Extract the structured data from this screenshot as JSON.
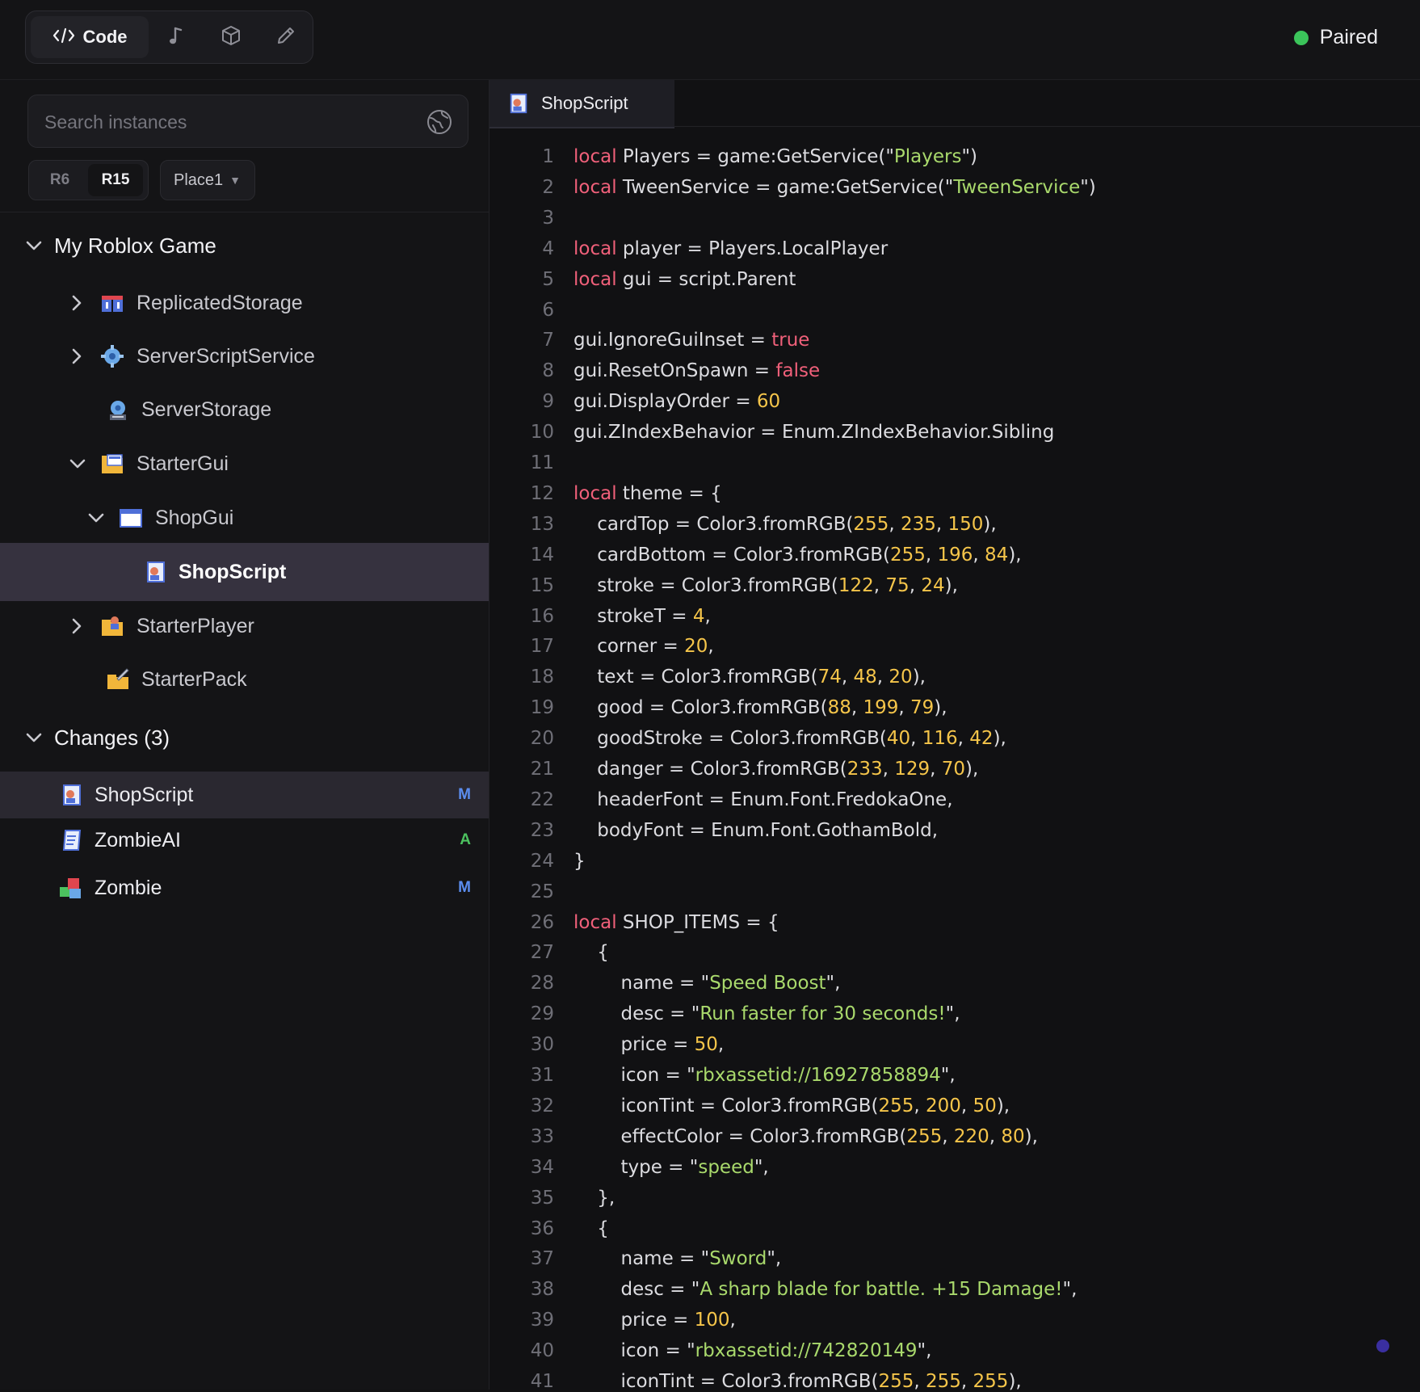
{
  "toolbar": {
    "code_label": "Code",
    "icons": [
      "code-icon",
      "music-note-icon",
      "cube-icon",
      "pencil-icon"
    ]
  },
  "status": {
    "label": "Paired",
    "color": "#3bc45a"
  },
  "sidebar": {
    "search_placeholder": "Search instances",
    "rig_options": [
      "R6",
      "R15"
    ],
    "rig_selected": "R15",
    "place_value": "Place1",
    "tree": {
      "root_label": "My Roblox Game",
      "items": [
        {
          "label": "ReplicatedStorage",
          "icon": "replicated-storage-icon",
          "chevron": "right"
        },
        {
          "label": "ServerScriptService",
          "icon": "server-script-service-icon",
          "chevron": "right"
        },
        {
          "label": "ServerStorage",
          "icon": "server-storage-icon",
          "chevron": "none"
        },
        {
          "label": "StarterGui",
          "icon": "starter-gui-icon",
          "chevron": "down"
        },
        {
          "label": "ShopGui",
          "icon": "screen-gui-icon",
          "chevron": "down"
        },
        {
          "label": "ShopScript",
          "icon": "local-script-icon",
          "chevron": "none",
          "selected": true
        },
        {
          "label": "StarterPlayer",
          "icon": "starter-player-icon",
          "chevron": "right"
        },
        {
          "label": "StarterPack",
          "icon": "starter-pack-icon",
          "chevron": "none"
        }
      ]
    },
    "changes": {
      "header": "Changes (3)",
      "items": [
        {
          "label": "ShopScript",
          "badge": "M",
          "badge_color": "#5b8def",
          "icon": "local-script-icon"
        },
        {
          "label": "ZombieAI",
          "badge": "A",
          "badge_color": "#4cc25f",
          "icon": "script-icon"
        },
        {
          "label": "Zombie",
          "badge": "M",
          "badge_color": "#5b8def",
          "icon": "model-icon"
        }
      ]
    }
  },
  "editor": {
    "tab_label": "ShopScript",
    "lines": [
      {
        "n": "1",
        "tokens": [
          [
            "kw",
            "local"
          ],
          [
            "plain",
            " Players = game:GetService(\""
          ],
          [
            "str",
            "Players"
          ],
          [
            "plain",
            "\")"
          ]
        ]
      },
      {
        "n": "2",
        "tokens": [
          [
            "kw",
            "local"
          ],
          [
            "plain",
            " TweenService = game:GetService(\""
          ],
          [
            "str",
            "TweenService"
          ],
          [
            "plain",
            "\")"
          ]
        ]
      },
      {
        "n": "3",
        "tokens": []
      },
      {
        "n": "4",
        "tokens": [
          [
            "kw",
            "local"
          ],
          [
            "plain",
            " player = Players.LocalPlayer"
          ]
        ]
      },
      {
        "n": "5",
        "tokens": [
          [
            "kw",
            "local"
          ],
          [
            "plain",
            " gui = script.Parent"
          ]
        ]
      },
      {
        "n": "6",
        "tokens": []
      },
      {
        "n": "7",
        "tokens": [
          [
            "plain",
            "gui.IgnoreGuiInset = "
          ],
          [
            "bool",
            "true"
          ]
        ]
      },
      {
        "n": "8",
        "tokens": [
          [
            "plain",
            "gui.ResetOnSpawn = "
          ],
          [
            "bool",
            "false"
          ]
        ]
      },
      {
        "n": "9",
        "tokens": [
          [
            "plain",
            "gui.DisplayOrder = "
          ],
          [
            "num",
            "60"
          ]
        ]
      },
      {
        "n": "10",
        "tokens": [
          [
            "plain",
            "gui.ZIndexBehavior = Enum.ZIndexBehavior.Sibling"
          ]
        ]
      },
      {
        "n": "11",
        "tokens": []
      },
      {
        "n": "12",
        "tokens": [
          [
            "kw",
            "local"
          ],
          [
            "plain",
            " theme = {"
          ]
        ]
      },
      {
        "n": "13",
        "tokens": [
          [
            "plain",
            "    cardTop = Color3.fromRGB("
          ],
          [
            "num",
            "255"
          ],
          [
            "plain",
            ", "
          ],
          [
            "num",
            "235"
          ],
          [
            "plain",
            ", "
          ],
          [
            "num",
            "150"
          ],
          [
            "plain",
            "),"
          ]
        ]
      },
      {
        "n": "14",
        "tokens": [
          [
            "plain",
            "    cardBottom = Color3.fromRGB("
          ],
          [
            "num",
            "255"
          ],
          [
            "plain",
            ", "
          ],
          [
            "num",
            "196"
          ],
          [
            "plain",
            ", "
          ],
          [
            "num",
            "84"
          ],
          [
            "plain",
            "),"
          ]
        ]
      },
      {
        "n": "15",
        "tokens": [
          [
            "plain",
            "    stroke = Color3.fromRGB("
          ],
          [
            "num",
            "122"
          ],
          [
            "plain",
            ", "
          ],
          [
            "num",
            "75"
          ],
          [
            "plain",
            ", "
          ],
          [
            "num",
            "24"
          ],
          [
            "plain",
            "),"
          ]
        ]
      },
      {
        "n": "16",
        "tokens": [
          [
            "plain",
            "    strokeT = "
          ],
          [
            "num",
            "4"
          ],
          [
            "plain",
            ","
          ]
        ]
      },
      {
        "n": "17",
        "tokens": [
          [
            "plain",
            "    corner = "
          ],
          [
            "num",
            "20"
          ],
          [
            "plain",
            ","
          ]
        ]
      },
      {
        "n": "18",
        "tokens": [
          [
            "plain",
            "    text = Color3.fromRGB("
          ],
          [
            "num",
            "74"
          ],
          [
            "plain",
            ", "
          ],
          [
            "num",
            "48"
          ],
          [
            "plain",
            ", "
          ],
          [
            "num",
            "20"
          ],
          [
            "plain",
            "),"
          ]
        ]
      },
      {
        "n": "19",
        "tokens": [
          [
            "plain",
            "    good = Color3.fromRGB("
          ],
          [
            "num",
            "88"
          ],
          [
            "plain",
            ", "
          ],
          [
            "num",
            "199"
          ],
          [
            "plain",
            ", "
          ],
          [
            "num",
            "79"
          ],
          [
            "plain",
            "),"
          ]
        ]
      },
      {
        "n": "20",
        "tokens": [
          [
            "plain",
            "    goodStroke = Color3.fromRGB("
          ],
          [
            "num",
            "40"
          ],
          [
            "plain",
            ", "
          ],
          [
            "num",
            "116"
          ],
          [
            "plain",
            ", "
          ],
          [
            "num",
            "42"
          ],
          [
            "plain",
            "),"
          ]
        ]
      },
      {
        "n": "21",
        "tokens": [
          [
            "plain",
            "    danger = Color3.fromRGB("
          ],
          [
            "num",
            "233"
          ],
          [
            "plain",
            ", "
          ],
          [
            "num",
            "129"
          ],
          [
            "plain",
            ", "
          ],
          [
            "num",
            "70"
          ],
          [
            "plain",
            "),"
          ]
        ]
      },
      {
        "n": "22",
        "tokens": [
          [
            "plain",
            "    headerFont = Enum.Font.FredokaOne,"
          ]
        ]
      },
      {
        "n": "23",
        "tokens": [
          [
            "plain",
            "    bodyFont = Enum.Font.GothamBold,"
          ]
        ]
      },
      {
        "n": "24",
        "tokens": [
          [
            "plain",
            "}"
          ]
        ]
      },
      {
        "n": "25",
        "tokens": []
      },
      {
        "n": "26",
        "tokens": [
          [
            "kw",
            "local"
          ],
          [
            "plain",
            " SHOP_ITEMS = {"
          ]
        ]
      },
      {
        "n": "27",
        "tokens": [
          [
            "plain",
            "    {"
          ]
        ]
      },
      {
        "n": "28",
        "tokens": [
          [
            "plain",
            "        name = \""
          ],
          [
            "str",
            "Speed Boost"
          ],
          [
            "plain",
            "\","
          ]
        ]
      },
      {
        "n": "29",
        "tokens": [
          [
            "plain",
            "        desc = \""
          ],
          [
            "str",
            "Run faster for 30 seconds!"
          ],
          [
            "plain",
            "\","
          ]
        ]
      },
      {
        "n": "30",
        "tokens": [
          [
            "plain",
            "        price = "
          ],
          [
            "num",
            "50"
          ],
          [
            "plain",
            ","
          ]
        ]
      },
      {
        "n": "31",
        "tokens": [
          [
            "plain",
            "        icon = \""
          ],
          [
            "str",
            "rbxassetid://16927858894"
          ],
          [
            "plain",
            "\","
          ]
        ]
      },
      {
        "n": "32",
        "tokens": [
          [
            "plain",
            "        iconTint = Color3.fromRGB("
          ],
          [
            "num",
            "255"
          ],
          [
            "plain",
            ", "
          ],
          [
            "num",
            "200"
          ],
          [
            "plain",
            ", "
          ],
          [
            "num",
            "50"
          ],
          [
            "plain",
            "),"
          ]
        ]
      },
      {
        "n": "33",
        "tokens": [
          [
            "plain",
            "        effectColor = Color3.fromRGB("
          ],
          [
            "num",
            "255"
          ],
          [
            "plain",
            ", "
          ],
          [
            "num",
            "220"
          ],
          [
            "plain",
            ", "
          ],
          [
            "num",
            "80"
          ],
          [
            "plain",
            "),"
          ]
        ]
      },
      {
        "n": "34",
        "tokens": [
          [
            "plain",
            "        type = \""
          ],
          [
            "str",
            "speed"
          ],
          [
            "plain",
            "\","
          ]
        ]
      },
      {
        "n": "35",
        "tokens": [
          [
            "plain",
            "    },"
          ]
        ]
      },
      {
        "n": "36",
        "tokens": [
          [
            "plain",
            "    {"
          ]
        ]
      },
      {
        "n": "37",
        "tokens": [
          [
            "plain",
            "        name = \""
          ],
          [
            "str",
            "Sword"
          ],
          [
            "plain",
            "\","
          ]
        ]
      },
      {
        "n": "38",
        "tokens": [
          [
            "plain",
            "        desc = \""
          ],
          [
            "str",
            "A sharp blade for battle. +15 Damage!"
          ],
          [
            "plain",
            "\","
          ]
        ]
      },
      {
        "n": "39",
        "tokens": [
          [
            "plain",
            "        price = "
          ],
          [
            "num",
            "100"
          ],
          [
            "plain",
            ","
          ]
        ]
      },
      {
        "n": "40",
        "tokens": [
          [
            "plain",
            "        icon = \""
          ],
          [
            "str",
            "rbxassetid://742820149"
          ],
          [
            "plain",
            "\","
          ]
        ]
      },
      {
        "n": "41",
        "tokens": [
          [
            "plain",
            "        iconTint = Color3.fromRGB("
          ],
          [
            "num",
            "255"
          ],
          [
            "plain",
            ", "
          ],
          [
            "num",
            "255"
          ],
          [
            "plain",
            ", "
          ],
          [
            "num",
            "255"
          ],
          [
            "plain",
            "),"
          ]
        ]
      }
    ]
  }
}
